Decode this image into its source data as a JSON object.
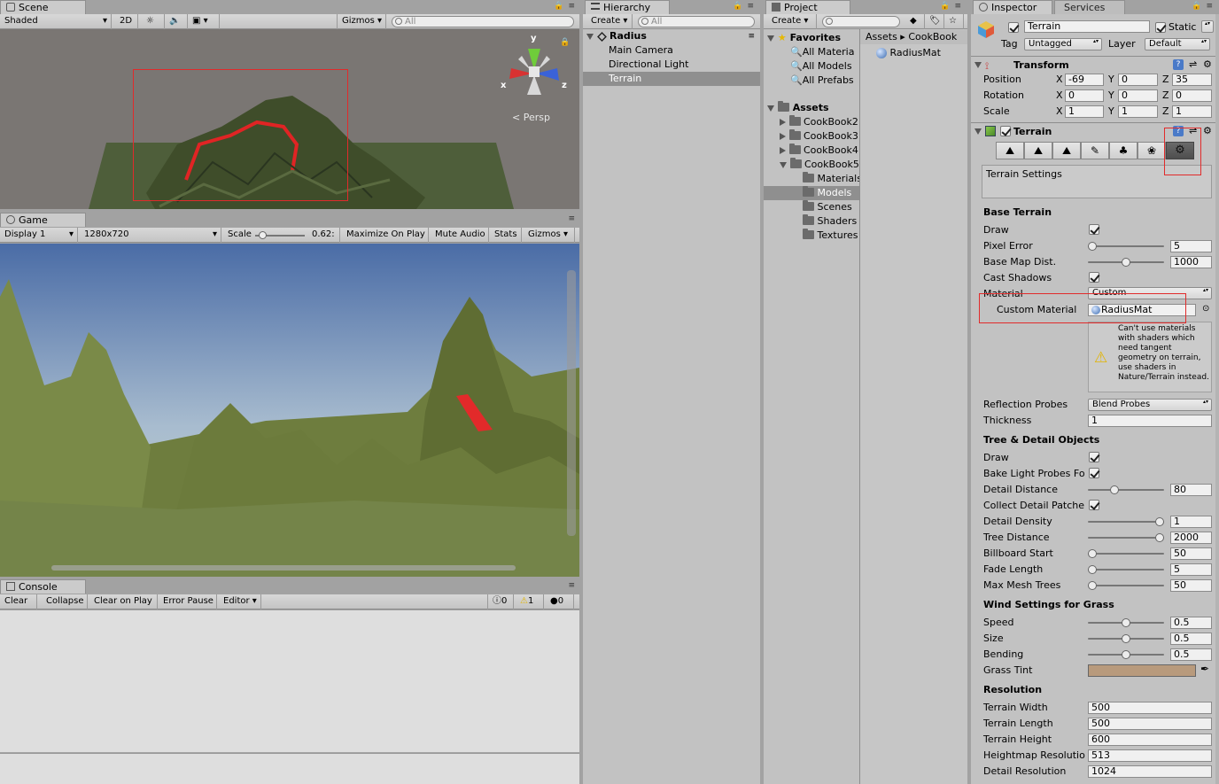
{
  "scene": {
    "tab": "Scene",
    "toolbar": {
      "shading": "Shaded",
      "mode2d": "2D",
      "gizmos": "Gizmos",
      "search_placeholder": "All"
    },
    "gizmo": {
      "y": "y",
      "x": "x",
      "z": "z",
      "persp": "Persp"
    }
  },
  "game": {
    "tab": "Game",
    "toolbar": {
      "display": "Display 1",
      "resolution": "1280x720",
      "scale_label": "Scale",
      "scale_value": "0.62:",
      "maximize": "Maximize On Play",
      "mute": "Mute Audio",
      "stats": "Stats",
      "gizmos": "Gizmos"
    }
  },
  "console": {
    "tab": "Console",
    "toolbar": {
      "clear": "Clear",
      "collapse": "Collapse",
      "clear_on_play": "Clear on Play",
      "error_pause": "Error Pause",
      "editor": "Editor",
      "log_count": "0",
      "warn_count": "1",
      "error_count": "0"
    }
  },
  "hierarchy": {
    "tab": "Hierarchy",
    "create": "Create",
    "search_placeholder": "All",
    "scene_name": "Radius",
    "items": [
      {
        "label": "Main Camera"
      },
      {
        "label": "Directional Light"
      },
      {
        "label": "Terrain"
      }
    ]
  },
  "project": {
    "tab": "Project",
    "create": "Create",
    "favorites_label": "Favorites",
    "favorites": [
      {
        "label": "All Materia"
      },
      {
        "label": "All Models"
      },
      {
        "label": "All Prefabs"
      }
    ],
    "assets_label": "Assets",
    "assets": [
      {
        "label": "CookBook2",
        "level": 1,
        "open": false
      },
      {
        "label": "CookBook3",
        "level": 1,
        "open": false
      },
      {
        "label": "CookBook4",
        "level": 1,
        "open": false
      },
      {
        "label": "CookBook5",
        "level": 1,
        "open": true
      },
      {
        "label": "Materials",
        "level": 2
      },
      {
        "label": "Models",
        "level": 2
      },
      {
        "label": "Scenes",
        "level": 2
      },
      {
        "label": "Shaders",
        "level": 2
      },
      {
        "label": "Textures",
        "level": 2
      }
    ],
    "breadcrumb": [
      "Assets",
      "CookBook"
    ],
    "files": [
      {
        "label": "RadiusMat"
      }
    ]
  },
  "inspector": {
    "tab": "Inspector",
    "tab2": "Services",
    "object_name": "Terrain",
    "static_label": "Static",
    "tag_label": "Tag",
    "tag_value": "Untagged",
    "layer_label": "Layer",
    "layer_value": "Default",
    "transform": {
      "title": "Transform",
      "position": {
        "label": "Position",
        "x": "-69",
        "y": "0",
        "z": "35"
      },
      "rotation": {
        "label": "Rotation",
        "x": "0",
        "y": "0",
        "z": "0"
      },
      "scale": {
        "label": "Scale",
        "x": "1",
        "y": "1",
        "z": "1"
      },
      "axis_x": "X",
      "axis_y": "Y",
      "axis_z": "Z"
    },
    "terrain": {
      "title": "Terrain",
      "settings_label": "Terrain Settings",
      "base_terrain": "Base Terrain",
      "draw": "Draw",
      "pixel_error": {
        "label": "Pixel Error",
        "value": "5",
        "fraction": 0.0
      },
      "base_map_dist": {
        "label": "Base Map Dist.",
        "value": "1000",
        "fraction": 0.5
      },
      "cast_shadows": "Cast Shadows",
      "material": {
        "label": "Material",
        "value": "Custom"
      },
      "custom_material": {
        "label": "Custom Material",
        "value": "RadiusMat"
      },
      "warning": "Can't use materials with shaders which need tangent geometry on terrain, use shaders in Nature/Terrain instead.",
      "reflection_probes": {
        "label": "Reflection Probes",
        "value": "Blend Probes"
      },
      "thickness": {
        "label": "Thickness",
        "value": "1"
      },
      "tree_detail": "Tree & Detail Objects",
      "draw2": "Draw",
      "bake_light_probes": "Bake Light Probes Fo",
      "detail_distance": {
        "label": "Detail Distance",
        "value": "80",
        "fraction": 0.33
      },
      "collect_detail": "Collect Detail Patche",
      "detail_density": {
        "label": "Detail Density",
        "value": "1",
        "fraction": 1.0
      },
      "tree_distance": {
        "label": "Tree Distance",
        "value": "2000",
        "fraction": 1.0
      },
      "billboard_start": {
        "label": "Billboard Start",
        "value": "50",
        "fraction": 0.0
      },
      "fade_length": {
        "label": "Fade Length",
        "value": "5",
        "fraction": 0.0
      },
      "max_mesh_trees": {
        "label": "Max Mesh Trees",
        "value": "50",
        "fraction": 0.0
      },
      "wind": "Wind Settings for Grass",
      "speed": {
        "label": "Speed",
        "value": "0.5",
        "fraction": 0.5
      },
      "size": {
        "label": "Size",
        "value": "0.5",
        "fraction": 0.5
      },
      "bending": {
        "label": "Bending",
        "value": "0.5",
        "fraction": 0.5
      },
      "grass_tint": {
        "label": "Grass Tint",
        "color": "#b89a7c"
      },
      "resolution": "Resolution",
      "terrain_width": {
        "label": "Terrain Width",
        "value": "500"
      },
      "terrain_length": {
        "label": "Terrain Length",
        "value": "500"
      },
      "terrain_height": {
        "label": "Terrain Height",
        "value": "600"
      },
      "heightmap_res": {
        "label": "Heightmap Resolutio",
        "value": "513"
      },
      "detail_res": {
        "label": "Detail Resolution",
        "value": "1024"
      }
    }
  },
  "colors": {
    "highlight_red": "#e12b2b",
    "selection": "#8f8f8f",
    "sky": "#4a6fa8",
    "terrain": "#6b7a3a"
  }
}
